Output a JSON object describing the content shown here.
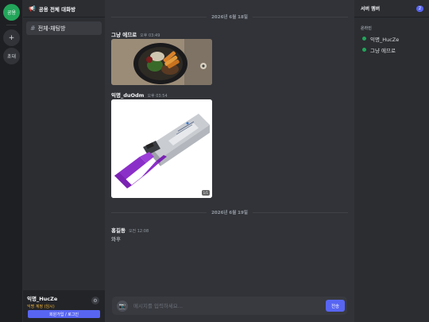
{
  "rail": {
    "server_label": "공용",
    "add_label": "+",
    "invite_label": "초대"
  },
  "channels": {
    "guild_name": "공용 전체 대화방",
    "items": [
      {
        "label": "전체-채팅방"
      }
    ]
  },
  "user_panel": {
    "name": "익명_HucZe",
    "status": "익명 계정 (임시)",
    "signup_label": "회원가입 / 로그인"
  },
  "chat": {
    "divider_1": "2026년 6월 18일",
    "messages": [
      {
        "author": "그냥 에므로",
        "time": "오후 03:49"
      },
      {
        "author": "익명_duOdm",
        "time": "오후 03:54",
        "image_badge": "1/1"
      },
      {
        "author": "홍길동",
        "time": "오전 12:08",
        "text": "와후"
      }
    ],
    "divider_2": "2026년 6월 19일"
  },
  "composer": {
    "placeholder": "메시지를 입력하세요...",
    "send_label": "전송"
  },
  "members": {
    "title": "서버 멤버",
    "count": "2",
    "section": "온라인",
    "list": [
      {
        "name": "익명_HucZe"
      },
      {
        "name": "그냥 에므로"
      }
    ]
  },
  "colors": {
    "accent": "#5865f2",
    "online": "#23a55a",
    "warning": "#f0b232",
    "module_purple": "#8b2fc9"
  }
}
